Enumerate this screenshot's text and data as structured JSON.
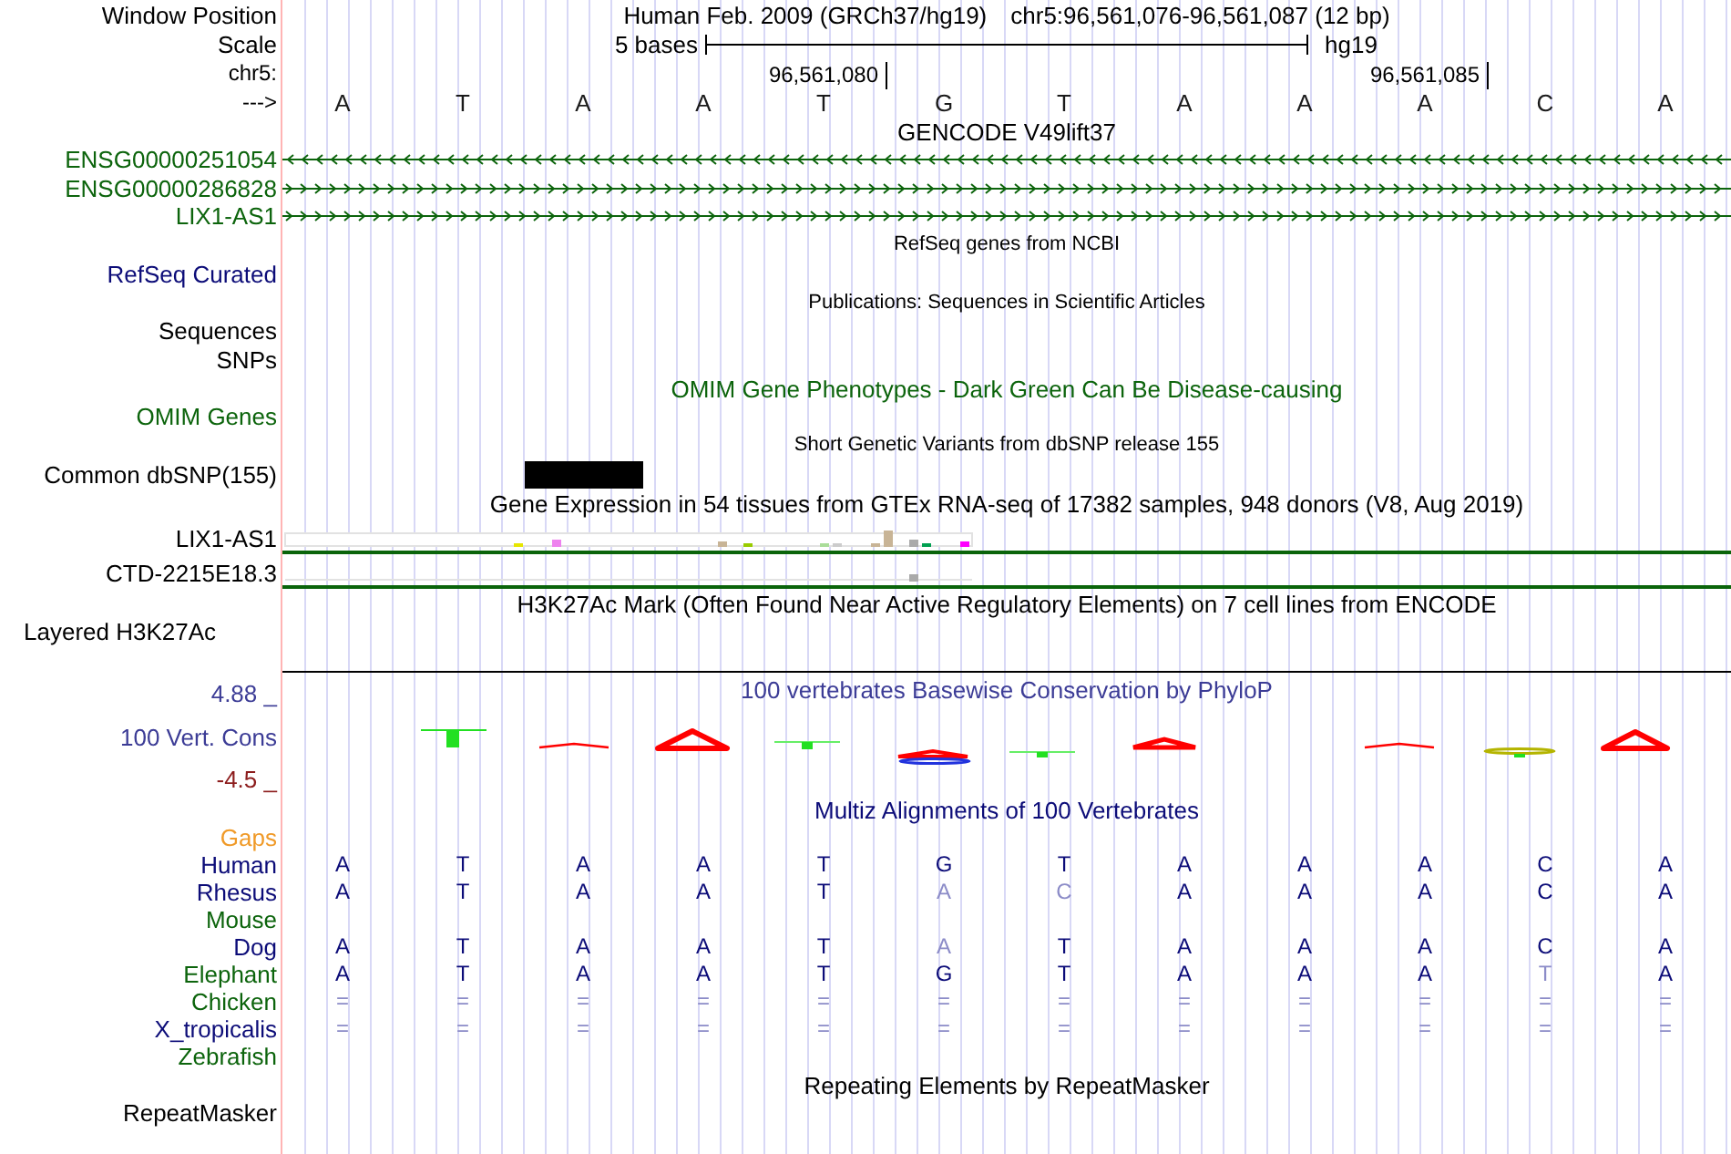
{
  "window_position": {
    "label": "Window Position",
    "assembly": "Human Feb. 2009 (GRCh37/hg19)",
    "range": "chr5:96,561,076-96,561,087 (12 bp)"
  },
  "scale": {
    "label": "Scale",
    "span": "5 bases",
    "assembly": "hg19"
  },
  "ruler": {
    "label": "chr5:"
  },
  "sequence": {
    "label": "--->",
    "bases": [
      {
        "base": "A"
      },
      {
        "base": "T"
      },
      {
        "base": "A",
        "common_snp": true
      },
      {
        "base": "A"
      },
      {
        "base": "T",
        "coordinate": "96,561,080"
      },
      {
        "base": "G"
      },
      {
        "base": "T"
      },
      {
        "base": "A"
      },
      {
        "base": "A"
      },
      {
        "base": "A",
        "coordinate": "96,561,085"
      },
      {
        "base": "C"
      },
      {
        "base": "A"
      }
    ]
  },
  "tracks": [
    {
      "kind": "genes",
      "title": {
        "text": "GENCODE V49lift37",
        "color": "#000000"
      },
      "color": "#0c640c",
      "items": [
        {
          "label": "ENSG00000251054",
          "reverse": true
        },
        {
          "label": "ENSG00000286828",
          "reverse": false
        },
        {
          "label": "LIX1-AS1",
          "reverse": false
        }
      ]
    },
    {
      "kind": "refseq",
      "title": {
        "text": "RefSeq genes from NCBI",
        "color": "#000000"
      },
      "color": "#0c0c78",
      "items": [
        {
          "label": "RefSeq Curated"
        }
      ]
    },
    {
      "kind": "publications",
      "title": {
        "text": "Publications: Sequences in Scientific Articles",
        "color": "#000000"
      },
      "color": "#000000",
      "items": [
        {
          "label": "Sequences"
        },
        {
          "label": "SNPs"
        }
      ]
    },
    {
      "kind": "omim",
      "title": {
        "text": "OMIM Gene Phenotypes - Dark Green Can Be Disease-causing",
        "color": "#0c640c"
      },
      "color": "#0c640c",
      "items": [
        {
          "label": "OMIM Genes"
        }
      ]
    },
    {
      "kind": "snp",
      "title": {
        "text": "Short Genetic Variants from dbSNP release 155",
        "color": "#000000"
      },
      "color": "#000000",
      "items": [
        {
          "label": "Common dbSNP(155)"
        }
      ]
    },
    {
      "kind": "expression",
      "title": {
        "text": "Gene Expression in 54 tissues from GTEx RNA-seq of 17382 samples, 948 donors (V8, Aug 2019)",
        "color": "#000000"
      },
      "color": "#000000",
      "items": [
        {
          "label": "LIX1-AS1"
        },
        {
          "label": "CTD-2215E18.3"
        }
      ]
    },
    {
      "kind": "layered",
      "title": {
        "text": "H3K27Ac Mark (Often Found Near Active Regulatory Elements) on 7 cell lines from ENCODE",
        "color": "#000000"
      },
      "color": "#000000",
      "items": [
        {
          "label": "Layered H3K27Ac"
        }
      ]
    },
    {
      "kind": "conservation",
      "title": {
        "text": "100 vertebrates Basewise Conservation by PhyloP",
        "color": "#3c3c96"
      },
      "color": "#3c3c96",
      "items": [
        {
          "label": "100 Vert. Cons",
          "axis_top": "4.88 _",
          "axis_bottom": "-4.5 _"
        }
      ]
    },
    {
      "kind": "alignment",
      "title": {
        "text": "Multiz Alignments of 100 Vertebrates",
        "color": "#0c0c78"
      },
      "items": [
        {
          "label": "Gaps",
          "color": "#f09a28"
        },
        {
          "label": "Human",
          "color": "#0c0c78",
          "bases": [
            {
              "base": "A",
              "faded": false
            },
            {
              "base": "T",
              "faded": false
            },
            {
              "base": "A",
              "faded": false
            },
            {
              "base": "A",
              "faded": false
            },
            {
              "base": "T",
              "faded": false
            },
            {
              "base": "G",
              "faded": false
            },
            {
              "base": "T",
              "faded": false
            },
            {
              "base": "A",
              "faded": false
            },
            {
              "base": "A",
              "faded": false
            },
            {
              "base": "A",
              "faded": false
            },
            {
              "base": "C",
              "faded": false
            },
            {
              "base": "A",
              "faded": false
            }
          ]
        },
        {
          "label": "Rhesus",
          "color": "#0c0c78",
          "bases": [
            {
              "base": "A",
              "faded": false
            },
            {
              "base": "T",
              "faded": false
            },
            {
              "base": "A",
              "faded": false
            },
            {
              "base": "A",
              "faded": false
            },
            {
              "base": "T",
              "faded": false
            },
            {
              "base": "A",
              "faded": true
            },
            {
              "base": "C",
              "faded": true
            },
            {
              "base": "A",
              "faded": false
            },
            {
              "base": "A",
              "faded": false
            },
            {
              "base": "A",
              "faded": false
            },
            {
              "base": "C",
              "faded": false
            },
            {
              "base": "A",
              "faded": false
            }
          ]
        },
        {
          "label": "Mouse",
          "color": "#0c640c"
        },
        {
          "label": "Dog",
          "color": "#0c0c78",
          "bases": [
            {
              "base": "A",
              "faded": false
            },
            {
              "base": "T",
              "faded": false
            },
            {
              "base": "A",
              "faded": false
            },
            {
              "base": "A",
              "faded": false
            },
            {
              "base": "T",
              "faded": false
            },
            {
              "base": "A",
              "faded": true
            },
            {
              "base": "T",
              "faded": false
            },
            {
              "base": "A",
              "faded": false
            },
            {
              "base": "A",
              "faded": false
            },
            {
              "base": "A",
              "faded": false
            },
            {
              "base": "C",
              "faded": false
            },
            {
              "base": "A",
              "faded": false
            }
          ]
        },
        {
          "label": "Elephant",
          "color": "#0c640c",
          "bases": [
            {
              "base": "A",
              "faded": false
            },
            {
              "base": "T",
              "faded": false
            },
            {
              "base": "A",
              "faded": false
            },
            {
              "base": "A",
              "faded": false
            },
            {
              "base": "T",
              "faded": false
            },
            {
              "base": "G",
              "faded": false
            },
            {
              "base": "T",
              "faded": false
            },
            {
              "base": "A",
              "faded": false
            },
            {
              "base": "A",
              "faded": false
            },
            {
              "base": "A",
              "faded": false
            },
            {
              "base": "T",
              "faded": true
            },
            {
              "base": "A",
              "faded": false
            }
          ]
        },
        {
          "label": "Chicken",
          "color": "#0c640c",
          "bases": [
            {
              "base": "=",
              "faded": true
            },
            {
              "base": "=",
              "faded": true
            },
            {
              "base": "=",
              "faded": true
            },
            {
              "base": "=",
              "faded": true
            },
            {
              "base": "=",
              "faded": true
            },
            {
              "base": "=",
              "faded": true
            },
            {
              "base": "=",
              "faded": true
            },
            {
              "base": "=",
              "faded": true
            },
            {
              "base": "=",
              "faded": true
            },
            {
              "base": "=",
              "faded": true
            },
            {
              "base": "=",
              "faded": true
            },
            {
              "base": "=",
              "faded": true
            }
          ]
        },
        {
          "label": "X_tropicalis",
          "color": "#0c0c78",
          "bases": [
            {
              "base": "=",
              "faded": true
            },
            {
              "base": "=",
              "faded": true
            },
            {
              "base": "=",
              "faded": true
            },
            {
              "base": "=",
              "faded": true
            },
            {
              "base": "=",
              "faded": true
            },
            {
              "base": "=",
              "faded": true
            },
            {
              "base": "=",
              "faded": true
            },
            {
              "base": "=",
              "faded": true
            },
            {
              "base": "=",
              "faded": true
            },
            {
              "base": "=",
              "faded": true
            },
            {
              "base": "=",
              "faded": true
            },
            {
              "base": "=",
              "faded": true
            }
          ]
        },
        {
          "label": "Zebrafish",
          "color": "#0c640c"
        }
      ]
    },
    {
      "kind": "repeats",
      "title": {
        "text": "Repeating Elements by RepeatMasker",
        "color": "#000000"
      },
      "color": "#000000",
      "items": [
        {
          "label": "RepeatMasker"
        }
      ]
    }
  ]
}
